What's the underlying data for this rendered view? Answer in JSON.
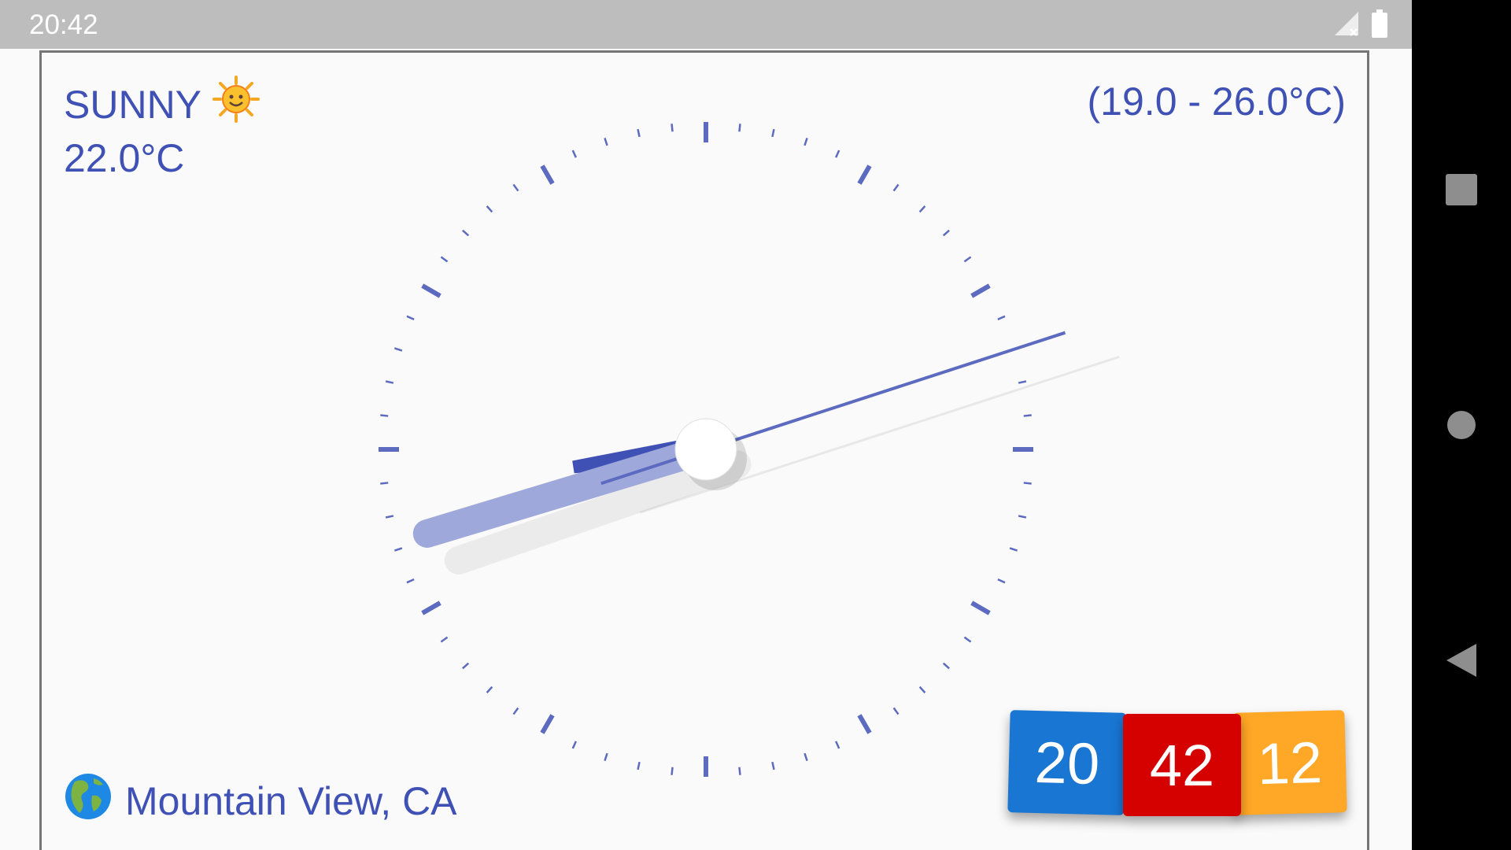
{
  "status_bar": {
    "time": "20:42",
    "icons": [
      "signal-off-icon",
      "battery-icon"
    ]
  },
  "weather": {
    "condition": "SUNNY",
    "condition_icon": "sun-face-icon",
    "temperature": "22.0°C",
    "range": "(19.0 - 26.0°C)"
  },
  "location": {
    "icon": "globe-americas-icon",
    "name": "Mountain View, CA"
  },
  "clock": {
    "hours": 20,
    "minutes": 42,
    "seconds": 12
  },
  "digital": {
    "hours": "20",
    "minutes": "42",
    "seconds": "12"
  },
  "colors": {
    "accent": "#3f51b5",
    "tick": "#5c6bc0",
    "minute_hand": "#9fa8da",
    "hour_tile": "#1976d2",
    "minute_tile": "#d50000",
    "second_tile": "#ffa726"
  },
  "nav_bar": {
    "buttons": [
      "recents-button",
      "home-button",
      "back-button"
    ]
  }
}
